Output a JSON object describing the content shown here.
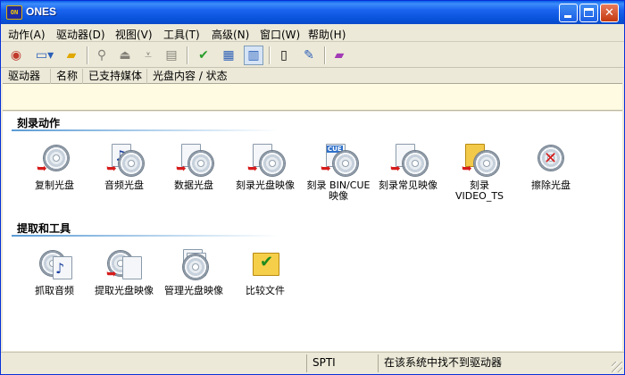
{
  "window": {
    "title": "ONES",
    "icon": "ones-logo-icon"
  },
  "menu": [
    {
      "label": "动作(A)"
    },
    {
      "label": "驱动器(D)"
    },
    {
      "label": "视图(V)"
    },
    {
      "label": "工具(T)"
    },
    {
      "label": "高级(N)"
    },
    {
      "label": "窗口(W)"
    },
    {
      "label": "帮助(H)"
    }
  ],
  "drive_columns": [
    "驱动器",
    "名称",
    "已支持媒体",
    "光盘内容 / 状态"
  ],
  "sections": {
    "burn": {
      "title": "刻录动作",
      "actions": [
        {
          "label": "复制光盘"
        },
        {
          "label": "音频光盘"
        },
        {
          "label": "数据光盘"
        },
        {
          "label": "刻录光盘映像"
        },
        {
          "label": "刻录 BIN/CUE\n映像"
        },
        {
          "label": "刻录常见映像"
        },
        {
          "label": "刻录\nVIDEO_TS"
        },
        {
          "label": "擦除光盘"
        }
      ]
    },
    "extract": {
      "title": "提取和工具",
      "actions": [
        {
          "label": "抓取音频"
        },
        {
          "label": "提取光盘映像"
        },
        {
          "label": "管理光盘映像"
        },
        {
          "label": "比较文件"
        }
      ]
    }
  },
  "status": {
    "interface": "SPTI",
    "message": "在该系统中找不到驱动器"
  },
  "colors": {
    "titlebar": "#0a5fe8",
    "drive_list_bg": "#fffbe3",
    "accent_red": "#d61c1c"
  }
}
